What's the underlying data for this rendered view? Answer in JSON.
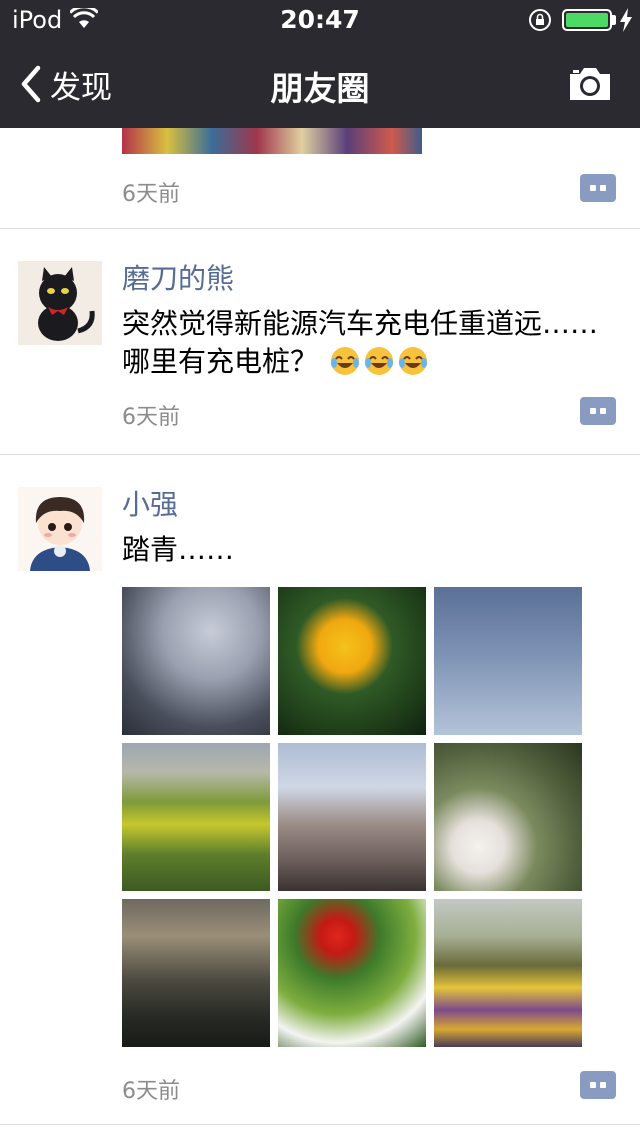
{
  "status": {
    "carrier": "iPod",
    "time": "20:47",
    "battery_color": "#4cd964"
  },
  "nav": {
    "back_label": "发现",
    "title": "朋友圈",
    "camera_icon": "camera-icon"
  },
  "colors": {
    "nav_bg": "#2b2a30",
    "author": "#576b95",
    "time": "#8c8c8c",
    "comment_button": "#8a9bc2"
  },
  "feed": {
    "posts": [
      {
        "time": "6天前"
      },
      {
        "author": "磨刀的熊",
        "text": "突然觉得新能源汽车充电任重道远……哪里有充电桩？",
        "emojis": [
          "face-with-tears-of-joy",
          "face-with-tears-of-joy",
          "face-with-tears-of-joy"
        ],
        "time": "6天前"
      },
      {
        "author": "小强",
        "text": "踏青……",
        "photos": 9,
        "time": "6天前"
      }
    ]
  }
}
